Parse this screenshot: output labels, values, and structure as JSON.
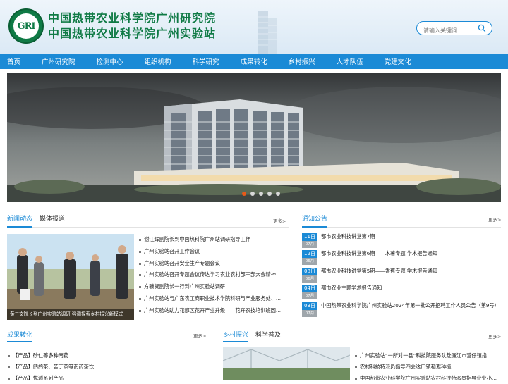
{
  "header": {
    "logo_text": "GRI",
    "title_line1": "中国热带农业科学院广州研究院",
    "title_line2": "中国热带农业科学院广州实验站",
    "search_placeholder": "请输入关键词"
  },
  "nav": [
    "首页",
    "广州研究院",
    "检测中心",
    "组织机构",
    "科学研究",
    "成果转化",
    "乡村振兴",
    "人才队伍",
    "党建文化"
  ],
  "banner": {
    "slide_count": 5,
    "active_slide": 1
  },
  "news": {
    "tabs": [
      "新闻动态",
      "媒体报道"
    ],
    "more": "更多>",
    "photo_caption": "黄三文院长到广州实验站调研 强调探索乡村振兴新模式",
    "items": [
      "谢江辉副院长到中国热科院广州站调研指导工作",
      "广州实验站召开工作会议",
      "广州实验站召开安全生产专题会议",
      "广州实验站召开专题会议传达学习农业农村部干部大会精神",
      "方骥贤副院长一行到广州实验站调研",
      "广州实验站与广东农工商职业技术学院科研与产业服务处、…",
      "广州实验站助力花都区花卉产业升级——花卉农技培训班圆…"
    ]
  },
  "notice": {
    "title": "通知公告",
    "more": "更多>",
    "items": [
      {
        "day": "11日",
        "month": "07月",
        "text": "都市农业科技讲堂第7期"
      },
      {
        "day": "12日",
        "month": "06月",
        "text": "都市农业科技讲堂第6期——木薯专题 学术报告通知"
      },
      {
        "day": "08日",
        "month": "06月",
        "text": "都市农业科技讲堂第5期——香蕉专题 学术报告通知"
      },
      {
        "day": "04日",
        "month": "07月",
        "text": "都市农业主题学术报告通知"
      },
      {
        "day": "03日",
        "month": "07月",
        "text": "中国热带农业科学院广州实验站2024年第一批公开招聘工作人员公告（第9号）"
      }
    ]
  },
  "achievements": {
    "title": "成果转化",
    "more": "更多>",
    "items": [
      "【产品】砂仁等多种南药",
      "【产品】鹧鸪茶、苦丁茶等南药茶饮",
      "【产品】忧遁系列产品"
    ]
  },
  "village": {
    "tabs": [
      "乡村振兴",
      "科学普及"
    ],
    "more": "更多>",
    "items": [
      "广州实验站“一所对一县”科技院服务队赴廉江市营仔镇指…",
      "农村科技特派员指导四会这口镇稻避种植",
      "中国热带农业科学院广州实验站农村科技特派员指导企业小…"
    ]
  },
  "colors": {
    "primary": "#1b8ad6",
    "logo_green": "#0f7a45",
    "active_dot": "#e85a19"
  }
}
